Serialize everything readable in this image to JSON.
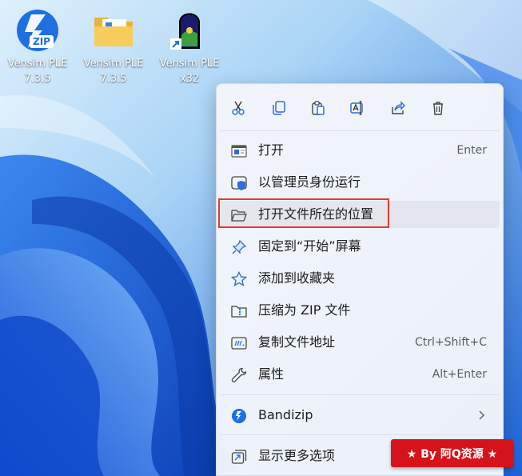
{
  "desktop": {
    "icons": [
      {
        "label": "Vensim PLE 7.3.5",
        "icon": "zip-installer-icon"
      },
      {
        "label": "Vensim PLE 7.3.5",
        "icon": "folder-icon"
      },
      {
        "label": "Vensim PLE x32",
        "icon": "vensim-app-shortcut-icon"
      }
    ],
    "zip_badge": "ZIP"
  },
  "action_bar": [
    {
      "name": "cut-icon"
    },
    {
      "name": "copy-icon"
    },
    {
      "name": "paste-icon"
    },
    {
      "name": "rename-icon"
    },
    {
      "name": "share-icon"
    },
    {
      "name": "delete-icon"
    }
  ],
  "menu": {
    "items": [
      {
        "label": "打开",
        "accelerator": "Enter",
        "icon": "open-app-icon"
      },
      {
        "label": "以管理员身份运行",
        "accelerator": "",
        "icon": "shield-icon"
      },
      {
        "label": "打开文件所在的位置",
        "accelerator": "",
        "icon": "folder-open-icon"
      },
      {
        "label": "固定到“开始”屏幕",
        "accelerator": "",
        "icon": "pin-icon"
      },
      {
        "label": "添加到收藏夹",
        "accelerator": "",
        "icon": "star-icon"
      },
      {
        "label": "压缩为 ZIP 文件",
        "accelerator": "",
        "icon": "zip-folder-icon"
      },
      {
        "label": "复制文件地址",
        "accelerator": "Ctrl+Shift+C",
        "icon": "copy-path-icon"
      },
      {
        "label": "属性",
        "accelerator": "Alt+Enter",
        "icon": "wrench-icon"
      },
      {
        "label": "Bandizip",
        "accelerator": "",
        "icon": "bandizip-icon"
      },
      {
        "label": "显示更多选项",
        "accelerator": "",
        "icon": "more-options-icon"
      }
    ]
  },
  "watermark": "★ By 阿Q资源 ★",
  "colors": {
    "menu_bg": "#f3f5fa",
    "highlight_border": "#e53935",
    "icon_accent": "#2f6fd6",
    "watermark_bg": "#d6121a"
  }
}
